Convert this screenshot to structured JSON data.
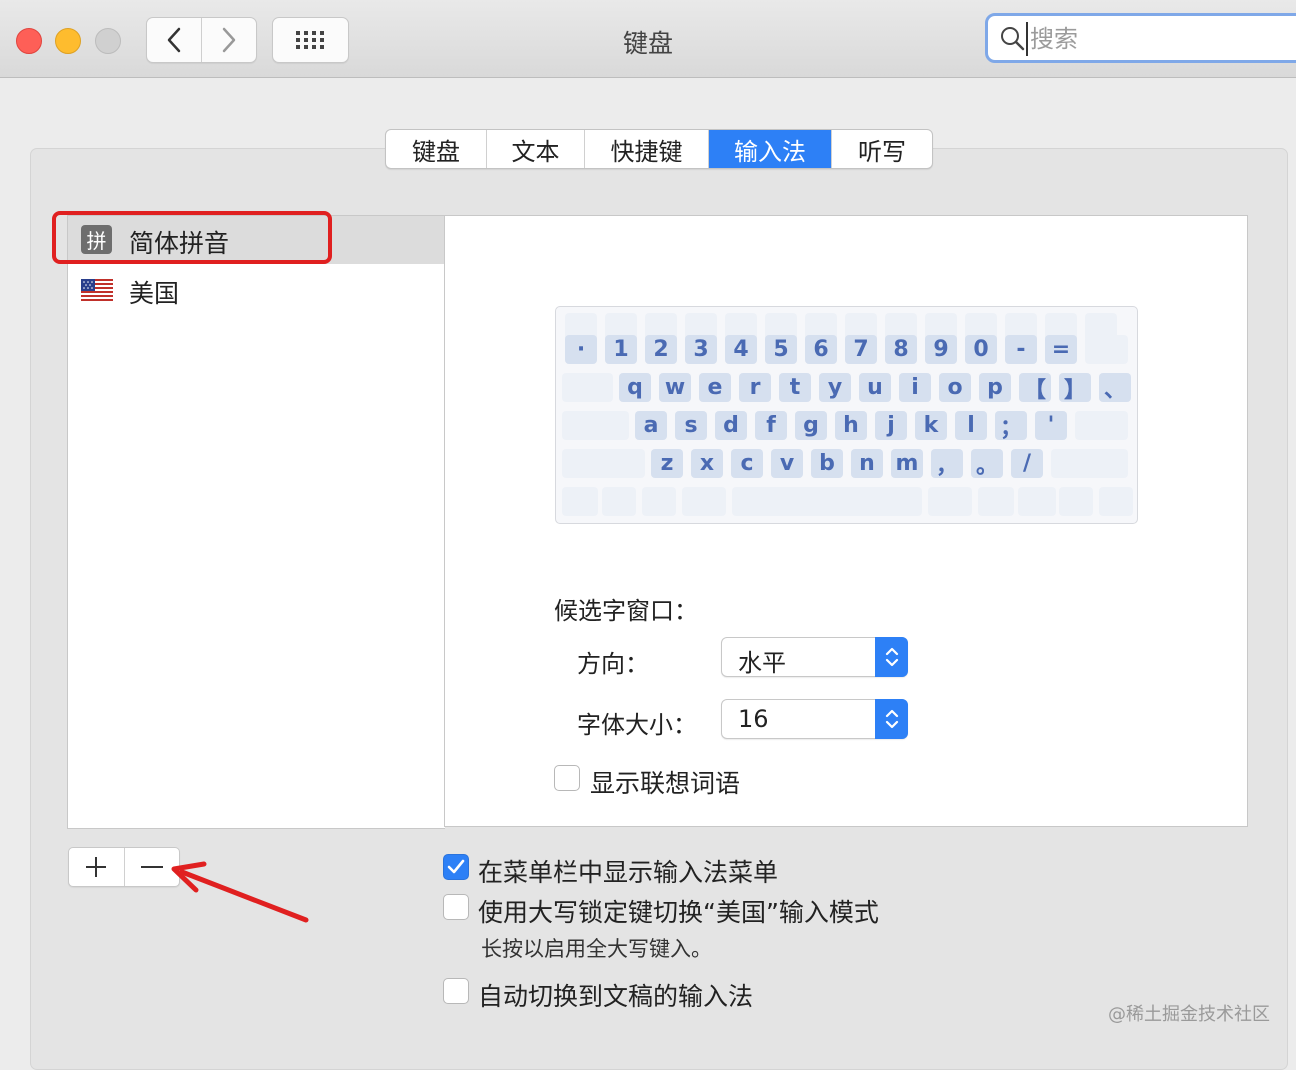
{
  "window": {
    "title": "键盘"
  },
  "search": {
    "placeholder": "搜索"
  },
  "tabs": [
    {
      "label": "键盘",
      "active": false
    },
    {
      "label": "文本",
      "active": false
    },
    {
      "label": "快捷键",
      "active": false
    },
    {
      "label": "输入法",
      "active": true
    },
    {
      "label": "听写",
      "active": false
    }
  ],
  "input_sources": [
    {
      "label": "简体拼音",
      "badge": "拼",
      "icon": "pinyin-badge-icon",
      "selected": true
    },
    {
      "label": "美国",
      "icon": "us-flag-icon",
      "selected": false
    }
  ],
  "keyboard": {
    "rows": [
      [
        "·",
        "1",
        "2",
        "3",
        "4",
        "5",
        "6",
        "7",
        "8",
        "9",
        "0",
        "-",
        "="
      ],
      [
        "q",
        "w",
        "e",
        "r",
        "t",
        "y",
        "u",
        "i",
        "o",
        "p",
        "【",
        "】",
        "、"
      ],
      [
        "a",
        "s",
        "d",
        "f",
        "g",
        "h",
        "j",
        "k",
        "l",
        "；",
        "'"
      ],
      [
        "z",
        "x",
        "c",
        "v",
        "b",
        "n",
        "m",
        "，",
        "。",
        "/"
      ]
    ]
  },
  "candidate_window": {
    "section_label": "候选字窗口：",
    "orientation_label": "方向：",
    "orientation_value": "水平",
    "font_size_label": "字体大小：",
    "font_size_value": "16"
  },
  "options": {
    "show_predictions": {
      "label": "显示联想词语",
      "checked": false
    },
    "show_in_menu_bar": {
      "label": "在菜单栏中显示输入法菜单",
      "checked": true
    },
    "caps_lock_switch": {
      "label": "使用大写锁定键切换“美国”输入模式",
      "checked": false
    },
    "caps_lock_hint": "长按以启用全大写键入。",
    "auto_switch": {
      "label": "自动切换到文稿的输入法",
      "checked": false
    }
  },
  "buttons": {
    "add": "+",
    "remove": "—"
  },
  "annotation": {
    "highlight_color": "#e02020",
    "arrow_color": "#e02020"
  },
  "colors": {
    "accent": "#2d80f6"
  },
  "watermark": "@稀土掘金技术社区"
}
